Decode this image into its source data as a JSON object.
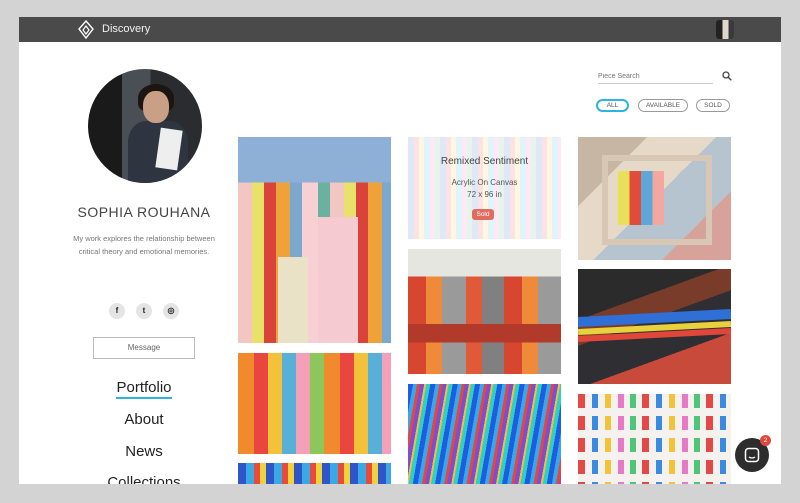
{
  "app": {
    "brand": "Discovery"
  },
  "profile": {
    "name": "SOPHIA ROUHANA",
    "bio": "My work explores the relationship between critical theory and emotional memories.",
    "message_label": "Message",
    "socials": [
      {
        "icon": "facebook-icon",
        "glyph": "f"
      },
      {
        "icon": "twitter-icon",
        "glyph": "t"
      },
      {
        "icon": "instagram-icon",
        "glyph": "◎"
      }
    ]
  },
  "nav": {
    "items": [
      {
        "label": "Portfolio",
        "active": true
      },
      {
        "label": "About",
        "active": false
      },
      {
        "label": "News",
        "active": false
      },
      {
        "label": "Collections",
        "active": false
      }
    ]
  },
  "search": {
    "placeholder": "Piece Search"
  },
  "filters": [
    {
      "label": "ALL",
      "active": true
    },
    {
      "label": "AVAILABLE",
      "active": false
    },
    {
      "label": "SOLD",
      "active": false
    }
  ],
  "hovered_artwork": {
    "title": "Remixed Sentiment",
    "medium": "Acrylic On Canvas",
    "size": "72 x 96 in",
    "status": "Sold"
  },
  "chat": {
    "unread": "2"
  },
  "colors": {
    "accent": "#2db4e0",
    "topbar": "#4a4a4a",
    "sold": "#e06b5e"
  }
}
